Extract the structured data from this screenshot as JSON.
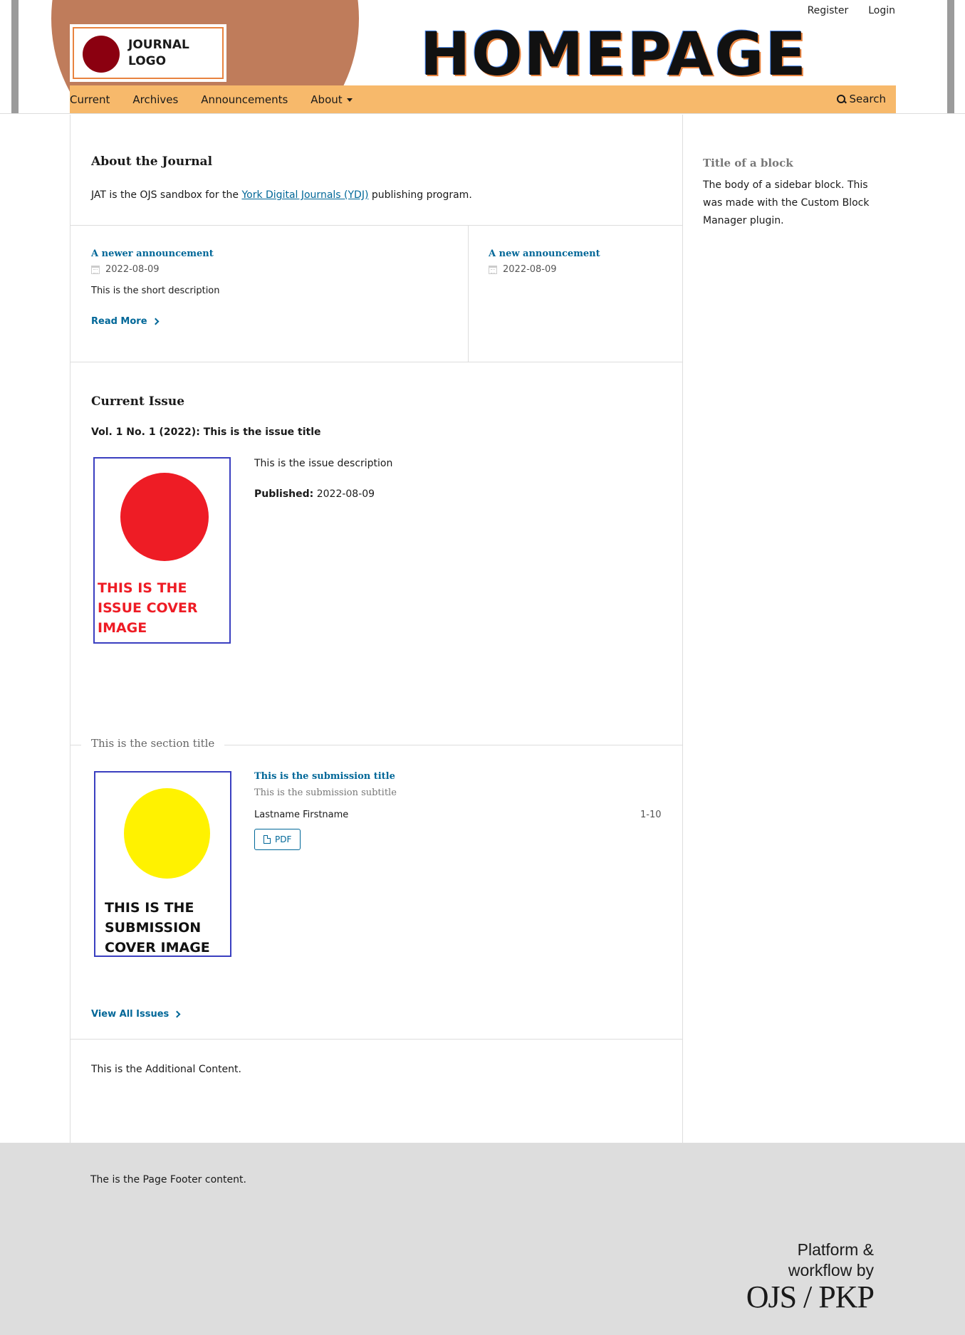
{
  "header": {
    "logo_text": "JOURNAL LOGO",
    "homepage_text": "HOMEPAGE",
    "user_nav": {
      "register": "Register",
      "login": "Login"
    },
    "nav": {
      "items": [
        "Current",
        "Archives",
        "Announcements",
        "About"
      ],
      "search_label": "Search"
    }
  },
  "about": {
    "heading": "About the Journal",
    "text_before": "JAT is the OJS sandbox for the ",
    "link_text": "York Digital Journals (YDJ)",
    "text_after": " publishing program."
  },
  "announcements": [
    {
      "title": "A newer announcement",
      "date": "2022-08-09",
      "description": "This is the short description",
      "read_more": "Read More"
    },
    {
      "title": "A new announcement",
      "date": "2022-08-09"
    }
  ],
  "current_issue": {
    "heading": "Current Issue",
    "issue_title": "Vol. 1 No. 1 (2022): This is the issue title",
    "description": "This is the issue description",
    "published_label": "Published:",
    "published_date": "2022-08-09",
    "cover_text": "THIS IS THE ISSUE COVER IMAGE"
  },
  "section": {
    "title": "This is the section title",
    "submission": {
      "title": "This is the submission title",
      "subtitle": "This is the submission subtitle",
      "authors": "Lastname Firstname",
      "pages": "1-10",
      "galley_label": "PDF",
      "cover_text": "THIS IS THE SUBMISSION COVER IMAGE"
    }
  },
  "view_all_issues": "View All Issues",
  "additional_content": "This is the Additional Content.",
  "sidebar": {
    "title": "Title of a block",
    "body": "The body of a sidebar block. This was made with the Custom Block Manager plugin."
  },
  "footer": {
    "text": "The is the Page Footer content.",
    "pkp_line1": "Platform &",
    "pkp_line2": "workflow by",
    "pkp_mark": "OJS / PKP"
  },
  "colors": {
    "nav_bg": "#f7b96b",
    "header_circle": "#bf7c5b",
    "link": "#006798",
    "issue_cover_circle": "#ee1c25",
    "submission_cover_circle": "#fff200",
    "cover_border": "#3a3fc0"
  }
}
